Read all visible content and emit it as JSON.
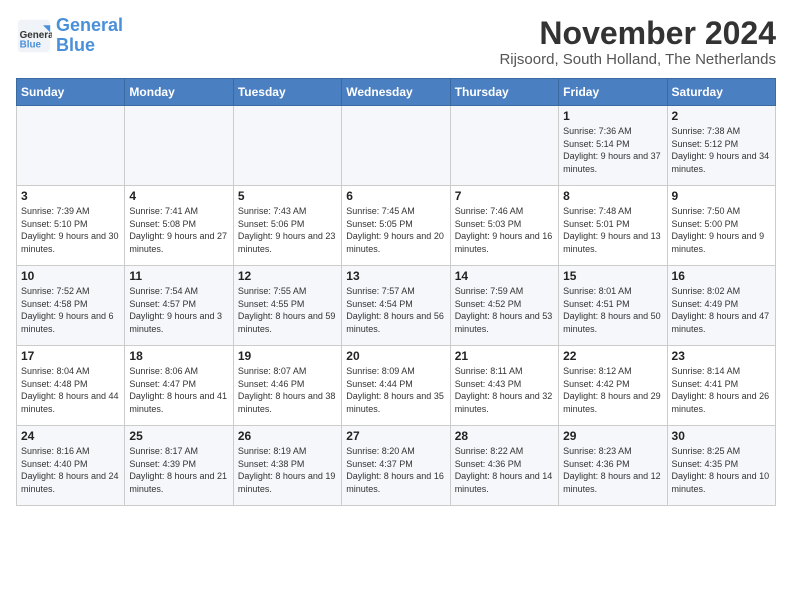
{
  "logo": {
    "line1": "General",
    "line2": "Blue"
  },
  "title": "November 2024",
  "subtitle": "Rijsoord, South Holland, The Netherlands",
  "days_of_week": [
    "Sunday",
    "Monday",
    "Tuesday",
    "Wednesday",
    "Thursday",
    "Friday",
    "Saturday"
  ],
  "weeks": [
    [
      {
        "day": "",
        "sunrise": "",
        "sunset": "",
        "daylight": ""
      },
      {
        "day": "",
        "sunrise": "",
        "sunset": "",
        "daylight": ""
      },
      {
        "day": "",
        "sunrise": "",
        "sunset": "",
        "daylight": ""
      },
      {
        "day": "",
        "sunrise": "",
        "sunset": "",
        "daylight": ""
      },
      {
        "day": "",
        "sunrise": "",
        "sunset": "",
        "daylight": ""
      },
      {
        "day": "1",
        "sunrise": "Sunrise: 7:36 AM",
        "sunset": "Sunset: 5:14 PM",
        "daylight": "Daylight: 9 hours and 37 minutes."
      },
      {
        "day": "2",
        "sunrise": "Sunrise: 7:38 AM",
        "sunset": "Sunset: 5:12 PM",
        "daylight": "Daylight: 9 hours and 34 minutes."
      }
    ],
    [
      {
        "day": "3",
        "sunrise": "Sunrise: 7:39 AM",
        "sunset": "Sunset: 5:10 PM",
        "daylight": "Daylight: 9 hours and 30 minutes."
      },
      {
        "day": "4",
        "sunrise": "Sunrise: 7:41 AM",
        "sunset": "Sunset: 5:08 PM",
        "daylight": "Daylight: 9 hours and 27 minutes."
      },
      {
        "day": "5",
        "sunrise": "Sunrise: 7:43 AM",
        "sunset": "Sunset: 5:06 PM",
        "daylight": "Daylight: 9 hours and 23 minutes."
      },
      {
        "day": "6",
        "sunrise": "Sunrise: 7:45 AM",
        "sunset": "Sunset: 5:05 PM",
        "daylight": "Daylight: 9 hours and 20 minutes."
      },
      {
        "day": "7",
        "sunrise": "Sunrise: 7:46 AM",
        "sunset": "Sunset: 5:03 PM",
        "daylight": "Daylight: 9 hours and 16 minutes."
      },
      {
        "day": "8",
        "sunrise": "Sunrise: 7:48 AM",
        "sunset": "Sunset: 5:01 PM",
        "daylight": "Daylight: 9 hours and 13 minutes."
      },
      {
        "day": "9",
        "sunrise": "Sunrise: 7:50 AM",
        "sunset": "Sunset: 5:00 PM",
        "daylight": "Daylight: 9 hours and 9 minutes."
      }
    ],
    [
      {
        "day": "10",
        "sunrise": "Sunrise: 7:52 AM",
        "sunset": "Sunset: 4:58 PM",
        "daylight": "Daylight: 9 hours and 6 minutes."
      },
      {
        "day": "11",
        "sunrise": "Sunrise: 7:54 AM",
        "sunset": "Sunset: 4:57 PM",
        "daylight": "Daylight: 9 hours and 3 minutes."
      },
      {
        "day": "12",
        "sunrise": "Sunrise: 7:55 AM",
        "sunset": "Sunset: 4:55 PM",
        "daylight": "Daylight: 8 hours and 59 minutes."
      },
      {
        "day": "13",
        "sunrise": "Sunrise: 7:57 AM",
        "sunset": "Sunset: 4:54 PM",
        "daylight": "Daylight: 8 hours and 56 minutes."
      },
      {
        "day": "14",
        "sunrise": "Sunrise: 7:59 AM",
        "sunset": "Sunset: 4:52 PM",
        "daylight": "Daylight: 8 hours and 53 minutes."
      },
      {
        "day": "15",
        "sunrise": "Sunrise: 8:01 AM",
        "sunset": "Sunset: 4:51 PM",
        "daylight": "Daylight: 8 hours and 50 minutes."
      },
      {
        "day": "16",
        "sunrise": "Sunrise: 8:02 AM",
        "sunset": "Sunset: 4:49 PM",
        "daylight": "Daylight: 8 hours and 47 minutes."
      }
    ],
    [
      {
        "day": "17",
        "sunrise": "Sunrise: 8:04 AM",
        "sunset": "Sunset: 4:48 PM",
        "daylight": "Daylight: 8 hours and 44 minutes."
      },
      {
        "day": "18",
        "sunrise": "Sunrise: 8:06 AM",
        "sunset": "Sunset: 4:47 PM",
        "daylight": "Daylight: 8 hours and 41 minutes."
      },
      {
        "day": "19",
        "sunrise": "Sunrise: 8:07 AM",
        "sunset": "Sunset: 4:46 PM",
        "daylight": "Daylight: 8 hours and 38 minutes."
      },
      {
        "day": "20",
        "sunrise": "Sunrise: 8:09 AM",
        "sunset": "Sunset: 4:44 PM",
        "daylight": "Daylight: 8 hours and 35 minutes."
      },
      {
        "day": "21",
        "sunrise": "Sunrise: 8:11 AM",
        "sunset": "Sunset: 4:43 PM",
        "daylight": "Daylight: 8 hours and 32 minutes."
      },
      {
        "day": "22",
        "sunrise": "Sunrise: 8:12 AM",
        "sunset": "Sunset: 4:42 PM",
        "daylight": "Daylight: 8 hours and 29 minutes."
      },
      {
        "day": "23",
        "sunrise": "Sunrise: 8:14 AM",
        "sunset": "Sunset: 4:41 PM",
        "daylight": "Daylight: 8 hours and 26 minutes."
      }
    ],
    [
      {
        "day": "24",
        "sunrise": "Sunrise: 8:16 AM",
        "sunset": "Sunset: 4:40 PM",
        "daylight": "Daylight: 8 hours and 24 minutes."
      },
      {
        "day": "25",
        "sunrise": "Sunrise: 8:17 AM",
        "sunset": "Sunset: 4:39 PM",
        "daylight": "Daylight: 8 hours and 21 minutes."
      },
      {
        "day": "26",
        "sunrise": "Sunrise: 8:19 AM",
        "sunset": "Sunset: 4:38 PM",
        "daylight": "Daylight: 8 hours and 19 minutes."
      },
      {
        "day": "27",
        "sunrise": "Sunrise: 8:20 AM",
        "sunset": "Sunset: 4:37 PM",
        "daylight": "Daylight: 8 hours and 16 minutes."
      },
      {
        "day": "28",
        "sunrise": "Sunrise: 8:22 AM",
        "sunset": "Sunset: 4:36 PM",
        "daylight": "Daylight: 8 hours and 14 minutes."
      },
      {
        "day": "29",
        "sunrise": "Sunrise: 8:23 AM",
        "sunset": "Sunset: 4:36 PM",
        "daylight": "Daylight: 8 hours and 12 minutes."
      },
      {
        "day": "30",
        "sunrise": "Sunrise: 8:25 AM",
        "sunset": "Sunset: 4:35 PM",
        "daylight": "Daylight: 8 hours and 10 minutes."
      }
    ]
  ]
}
